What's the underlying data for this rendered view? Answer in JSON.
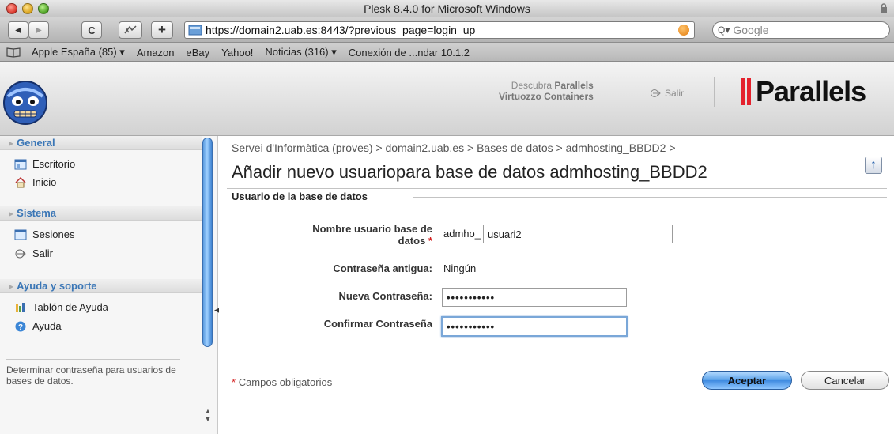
{
  "window": {
    "title": "Plesk 8.4.0 for Microsoft Windows"
  },
  "toolbar": {
    "back_label": "◀",
    "forward_label": "▶",
    "reload_label": "C",
    "add_label": "+",
    "url": "https://domain2.uab.es:8443/?previous_page=login_up",
    "search_placeholder": "Google"
  },
  "bookmarks": [
    "Apple España (85) ▾",
    "Amazon",
    "eBay",
    "Yahoo!",
    "Noticias (316) ▾",
    "Conexión de ...ndar 10.1.2"
  ],
  "header": {
    "promo_line1": "Descubra",
    "promo_line1_bold": "Parallels",
    "promo_line2": "Virtuozzo Containers",
    "logout_label": "Salir",
    "brand": "Parallels",
    "brand_color": "#e4222d"
  },
  "sidebar": {
    "sections": [
      {
        "title": "General",
        "items": [
          {
            "label": "Escritorio",
            "icon": "desktop-icon"
          },
          {
            "label": "Inicio",
            "icon": "home-icon"
          }
        ]
      },
      {
        "title": "Sistema",
        "items": [
          {
            "label": "Sesiones",
            "icon": "sessions-icon"
          },
          {
            "label": "Salir",
            "icon": "logout-icon"
          }
        ]
      },
      {
        "title": "Ayuda y soporte",
        "items": [
          {
            "label": "Tablón de Ayuda",
            "icon": "helpdesk-icon"
          },
          {
            "label": "Ayuda",
            "icon": "help-icon"
          }
        ]
      }
    ],
    "hint": "Determinar contraseña para usuarios de bases de datos."
  },
  "main": {
    "breadcrumb": [
      "Servei d'Informàtica (proves)",
      "domain2.uab.es",
      "Bases de datos",
      "admhosting_BBDD2"
    ],
    "breadcrumb_sep": ">",
    "title": "Añadir nuevo usuariopara base de datos admhosting_BBDD2",
    "fieldset_title": "Usuario de la base de datos",
    "fields": {
      "username_label_1": "Nombre usuario base de",
      "username_label_2": "datos",
      "username_prefix": "admho_",
      "username_value": "usuari2",
      "old_password_label": "Contraseña antigua:",
      "old_password_value": "Ningún",
      "new_password_label": "Nueva Contraseña:",
      "new_password_value": "•••••••••••",
      "confirm_password_label": "Confirmar Contraseña",
      "confirm_password_value": "•••••••••••"
    },
    "required_note": "Campos obligatorios",
    "required_mark": "*",
    "accept_label": "Aceptar",
    "cancel_label": "Cancelar"
  }
}
